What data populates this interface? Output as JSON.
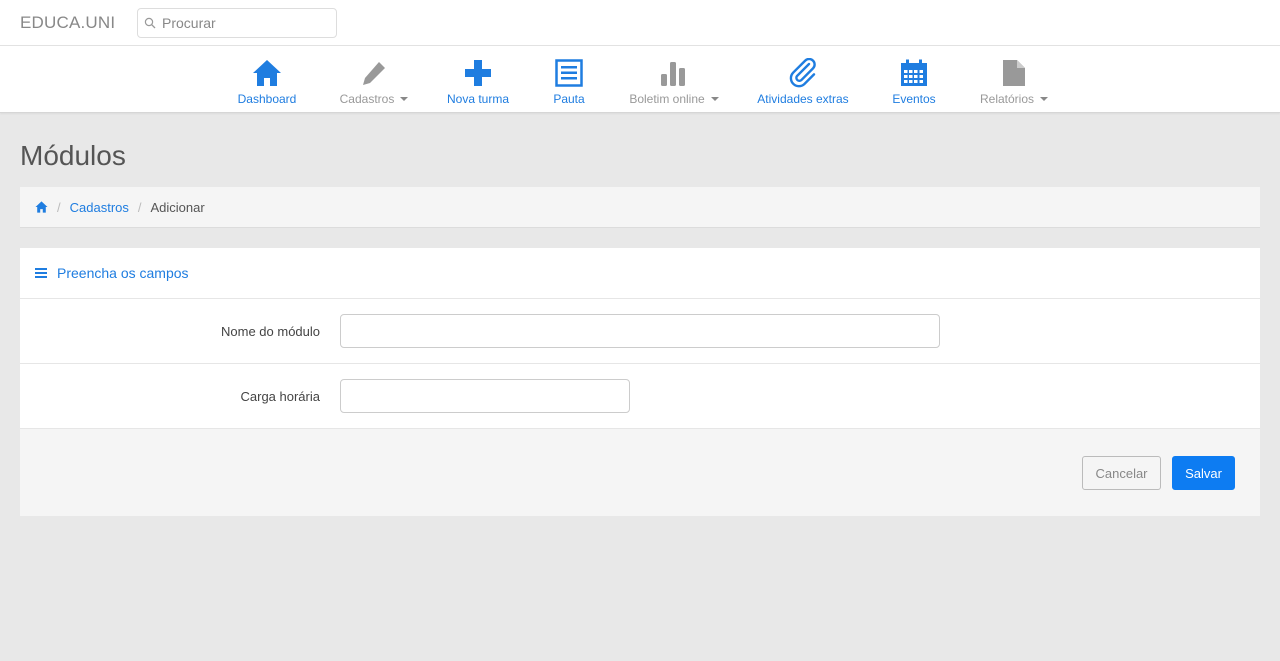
{
  "brand": "EDUCA.UNI",
  "search": {
    "placeholder": "Procurar"
  },
  "nav": {
    "items": [
      {
        "label": "Dashboard",
        "icon": "home-icon"
      },
      {
        "label": "Cadastros",
        "icon": "pencil-icon",
        "dropdown": true
      },
      {
        "label": "Nova turma",
        "icon": "plus-icon"
      },
      {
        "label": "Pauta",
        "icon": "list-icon"
      },
      {
        "label": "Boletim online",
        "icon": "bar-chart-icon",
        "dropdown": true
      },
      {
        "label": "Atividades extras",
        "icon": "paperclip-icon"
      },
      {
        "label": "Eventos",
        "icon": "calendar-icon"
      },
      {
        "label": "Relatórios",
        "icon": "file-icon",
        "dropdown": true
      }
    ]
  },
  "page": {
    "title": "Módulos"
  },
  "breadcrumb": {
    "home_icon": "home-icon",
    "items": [
      "Cadastros",
      "Adicionar"
    ]
  },
  "panel": {
    "title": "Preencha os campos",
    "fields": [
      {
        "label": "Nome do módulo",
        "value": ""
      },
      {
        "label": "Carga horária",
        "value": ""
      }
    ],
    "cancel_label": "Cancelar",
    "save_label": "Salvar"
  },
  "colors": {
    "accent": "#1f7de0",
    "primary_button": "#0d7cf2",
    "muted": "#999999",
    "background": "#e8e8e8"
  }
}
